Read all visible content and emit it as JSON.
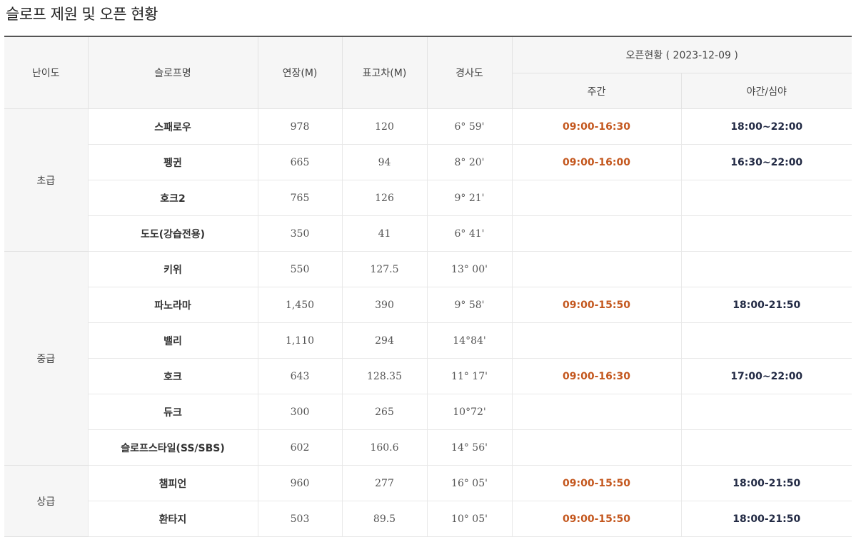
{
  "title": "슬로프 제원 및 오픈 현황",
  "header": {
    "difficulty": "난이도",
    "slope_name": "슬로프명",
    "length": "연장(M)",
    "elevation": "표고차(M)",
    "gradient": "경사도",
    "open_status": "오픈현황 ( 2023-12-09 )",
    "day": "주간",
    "night": "야간/심야"
  },
  "groups": [
    {
      "difficulty": "초급",
      "rows": [
        {
          "name": "스패로우",
          "length": "978",
          "elevation": "120",
          "gradient": "6° 59'",
          "day": "09:00-16:30",
          "night": "18:00~22:00"
        },
        {
          "name": "펭귄",
          "length": "665",
          "elevation": "94",
          "gradient": "8° 20'",
          "day": "09:00-16:00",
          "night": "16:30~22:00"
        },
        {
          "name": "호크2",
          "length": "765",
          "elevation": "126",
          "gradient": "9° 21'",
          "day": "",
          "night": ""
        },
        {
          "name": "도도(강습전용)",
          "length": "350",
          "elevation": "41",
          "gradient": "6° 41'",
          "day": "",
          "night": ""
        }
      ]
    },
    {
      "difficulty": "중급",
      "rows": [
        {
          "name": "키위",
          "length": "550",
          "elevation": "127.5",
          "gradient": "13° 00'",
          "day": "",
          "night": ""
        },
        {
          "name": "파노라마",
          "length": "1,450",
          "elevation": "390",
          "gradient": "9° 58'",
          "day": "09:00-15:50",
          "night": "18:00-21:50"
        },
        {
          "name": "밸리",
          "length": "1,110",
          "elevation": "294",
          "gradient": "14°84'",
          "day": "",
          "night": ""
        },
        {
          "name": "호크",
          "length": "643",
          "elevation": "128.35",
          "gradient": "11° 17'",
          "day": "09:00-16:30",
          "night": "17:00~22:00"
        },
        {
          "name": "듀크",
          "length": "300",
          "elevation": "265",
          "gradient": "10°72'",
          "day": "",
          "night": ""
        },
        {
          "name": "슬로프스타일(SS/SBS)",
          "length": "602",
          "elevation": "160.6",
          "gradient": "14° 56'",
          "day": "",
          "night": ""
        }
      ]
    },
    {
      "difficulty": "상급",
      "rows": [
        {
          "name": "챔피언",
          "length": "960",
          "elevation": "277",
          "gradient": "16° 05'",
          "day": "09:00-15:50",
          "night": "18:00-21:50"
        },
        {
          "name": "환타지",
          "length": "503",
          "elevation": "89.5",
          "gradient": "10° 05'",
          "day": "09:00-15:50",
          "night": "18:00-21:50"
        }
      ]
    }
  ]
}
